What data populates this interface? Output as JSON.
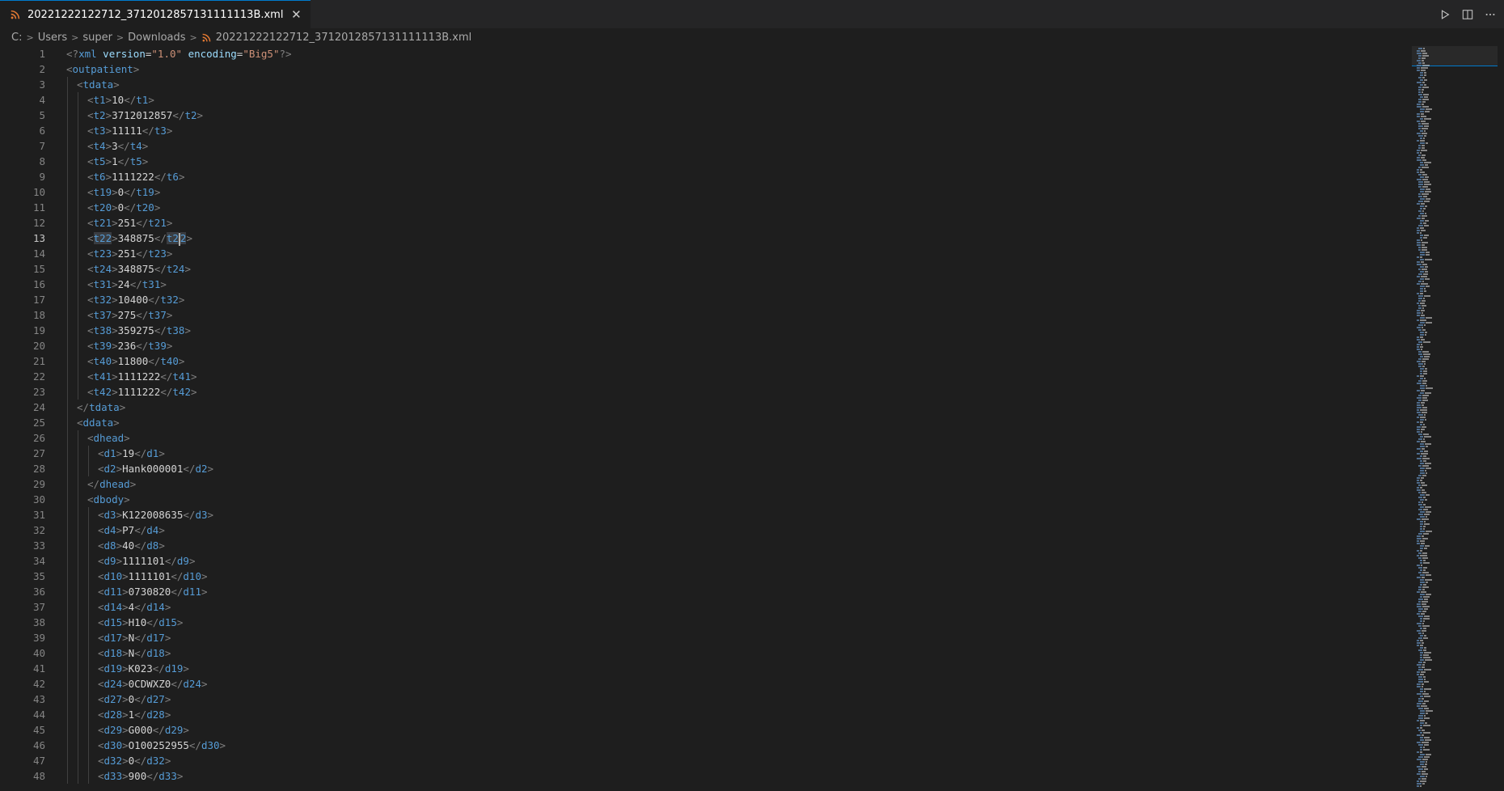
{
  "tab": {
    "label": "20221222122712_3712012857131111113B.xml",
    "close_glyph": "✕"
  },
  "breadcrumb": [
    "C:",
    "Users",
    "super",
    "Downloads",
    "20221222122712_3712012857131111113B.xml"
  ],
  "editor": {
    "current_line": 13,
    "lines": [
      {
        "n": 1,
        "i": 0,
        "decl": true
      },
      {
        "n": 2,
        "i": 0,
        "k": "open",
        "tag": "outpatient"
      },
      {
        "n": 3,
        "i": 1,
        "k": "open",
        "tag": "tdata"
      },
      {
        "n": 4,
        "i": 2,
        "k": "el",
        "tag": "t1",
        "v": "10"
      },
      {
        "n": 5,
        "i": 2,
        "k": "el",
        "tag": "t2",
        "v": "3712012857"
      },
      {
        "n": 6,
        "i": 2,
        "k": "el",
        "tag": "t3",
        "v": "11111"
      },
      {
        "n": 7,
        "i": 2,
        "k": "el",
        "tag": "t4",
        "v": "3"
      },
      {
        "n": 8,
        "i": 2,
        "k": "el",
        "tag": "t5",
        "v": "1"
      },
      {
        "n": 9,
        "i": 2,
        "k": "el",
        "tag": "t6",
        "v": "1111222"
      },
      {
        "n": 10,
        "i": 2,
        "k": "el",
        "tag": "t19",
        "v": "0"
      },
      {
        "n": 11,
        "i": 2,
        "k": "el",
        "tag": "t20",
        "v": "0"
      },
      {
        "n": 12,
        "i": 2,
        "k": "el",
        "tag": "t21",
        "v": "251"
      },
      {
        "n": 13,
        "i": 2,
        "k": "el",
        "tag": "t22",
        "v": "348875"
      },
      {
        "n": 14,
        "i": 2,
        "k": "el",
        "tag": "t23",
        "v": "251"
      },
      {
        "n": 15,
        "i": 2,
        "k": "el",
        "tag": "t24",
        "v": "348875"
      },
      {
        "n": 16,
        "i": 2,
        "k": "el",
        "tag": "t31",
        "v": "24"
      },
      {
        "n": 17,
        "i": 2,
        "k": "el",
        "tag": "t32",
        "v": "10400"
      },
      {
        "n": 18,
        "i": 2,
        "k": "el",
        "tag": "t37",
        "v": "275"
      },
      {
        "n": 19,
        "i": 2,
        "k": "el",
        "tag": "t38",
        "v": "359275"
      },
      {
        "n": 20,
        "i": 2,
        "k": "el",
        "tag": "t39",
        "v": "236"
      },
      {
        "n": 21,
        "i": 2,
        "k": "el",
        "tag": "t40",
        "v": "11800"
      },
      {
        "n": 22,
        "i": 2,
        "k": "el",
        "tag": "t41",
        "v": "1111222"
      },
      {
        "n": 23,
        "i": 2,
        "k": "el",
        "tag": "t42",
        "v": "1111222"
      },
      {
        "n": 24,
        "i": 1,
        "k": "close",
        "tag": "tdata"
      },
      {
        "n": 25,
        "i": 1,
        "k": "open",
        "tag": "ddata"
      },
      {
        "n": 26,
        "i": 2,
        "k": "open",
        "tag": "dhead"
      },
      {
        "n": 27,
        "i": 3,
        "k": "el",
        "tag": "d1",
        "v": "19"
      },
      {
        "n": 28,
        "i": 3,
        "k": "el",
        "tag": "d2",
        "v": "Hank000001"
      },
      {
        "n": 29,
        "i": 2,
        "k": "close",
        "tag": "dhead"
      },
      {
        "n": 30,
        "i": 2,
        "k": "open",
        "tag": "dbody"
      },
      {
        "n": 31,
        "i": 3,
        "k": "el",
        "tag": "d3",
        "v": "K122008635"
      },
      {
        "n": 32,
        "i": 3,
        "k": "el",
        "tag": "d4",
        "v": "P7"
      },
      {
        "n": 33,
        "i": 3,
        "k": "el",
        "tag": "d8",
        "v": "40"
      },
      {
        "n": 34,
        "i": 3,
        "k": "el",
        "tag": "d9",
        "v": "1111101"
      },
      {
        "n": 35,
        "i": 3,
        "k": "el",
        "tag": "d10",
        "v": "1111101"
      },
      {
        "n": 36,
        "i": 3,
        "k": "el",
        "tag": "d11",
        "v": "0730820"
      },
      {
        "n": 37,
        "i": 3,
        "k": "el",
        "tag": "d14",
        "v": "4"
      },
      {
        "n": 38,
        "i": 3,
        "k": "el",
        "tag": "d15",
        "v": "H10"
      },
      {
        "n": 39,
        "i": 3,
        "k": "el",
        "tag": "d17",
        "v": "N"
      },
      {
        "n": 40,
        "i": 3,
        "k": "el",
        "tag": "d18",
        "v": "N"
      },
      {
        "n": 41,
        "i": 3,
        "k": "el",
        "tag": "d19",
        "v": "K023"
      },
      {
        "n": 42,
        "i": 3,
        "k": "el",
        "tag": "d24",
        "v": "0CDWXZ0"
      },
      {
        "n": 43,
        "i": 3,
        "k": "el",
        "tag": "d27",
        "v": "0"
      },
      {
        "n": 44,
        "i": 3,
        "k": "el",
        "tag": "d28",
        "v": "1"
      },
      {
        "n": 45,
        "i": 3,
        "k": "el",
        "tag": "d29",
        "v": "G000"
      },
      {
        "n": 46,
        "i": 3,
        "k": "el",
        "tag": "d30",
        "v": "O100252955"
      },
      {
        "n": 47,
        "i": 3,
        "k": "el",
        "tag": "d32",
        "v": "0"
      },
      {
        "n": 48,
        "i": 3,
        "k": "el",
        "tag": "d33",
        "v": "900"
      }
    ]
  },
  "xml_decl": {
    "version": "1.0",
    "encoding": "Big5"
  },
  "colors": {
    "tag": "#569cd6",
    "bracket": "#808080",
    "attr": "#9cdcfe",
    "string": "#ce9178",
    "text": "#d4d4d4",
    "rss_icon": "#e37933"
  },
  "icons": {
    "file": "rss-xml-icon",
    "run": "run-icon",
    "split": "split-editor-icon",
    "more": "more-actions-icon",
    "chevron": "chevron-right-icon"
  }
}
